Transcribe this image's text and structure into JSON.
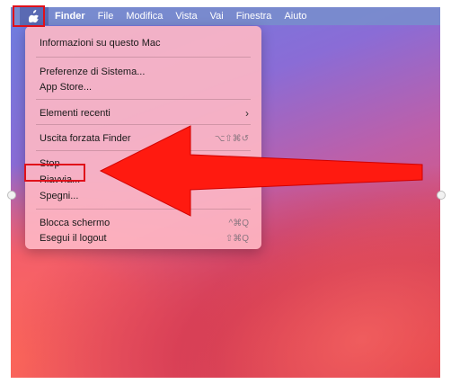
{
  "menubar": {
    "apple_icon": "apple-icon",
    "items": [
      {
        "label": "Finder"
      },
      {
        "label": "File"
      },
      {
        "label": "Modifica"
      },
      {
        "label": "Vista"
      },
      {
        "label": "Vai"
      },
      {
        "label": "Finestra"
      },
      {
        "label": "Aiuto"
      }
    ]
  },
  "apple_menu": {
    "items": [
      {
        "label": "Informazioni su questo Mac"
      },
      {
        "label": "Preferenze di Sistema..."
      },
      {
        "label": "App Store..."
      },
      {
        "label": "Elementi recenti",
        "submenu": "chevron-right-icon"
      },
      {
        "label": "Uscita forzata Finder",
        "shortcut": "⌥⇧⌘↺"
      },
      {
        "label": "Stop"
      },
      {
        "label": "Riavvia..."
      },
      {
        "label": "Spegni..."
      },
      {
        "label": "Blocca schermo",
        "shortcut": "^⌘Q"
      },
      {
        "label": "Esegui il logout",
        "shortcut": "⇧⌘Q"
      }
    ]
  },
  "annotations": {
    "highlight_color": "#e0101a",
    "arrow_color": "#ff1a10"
  }
}
